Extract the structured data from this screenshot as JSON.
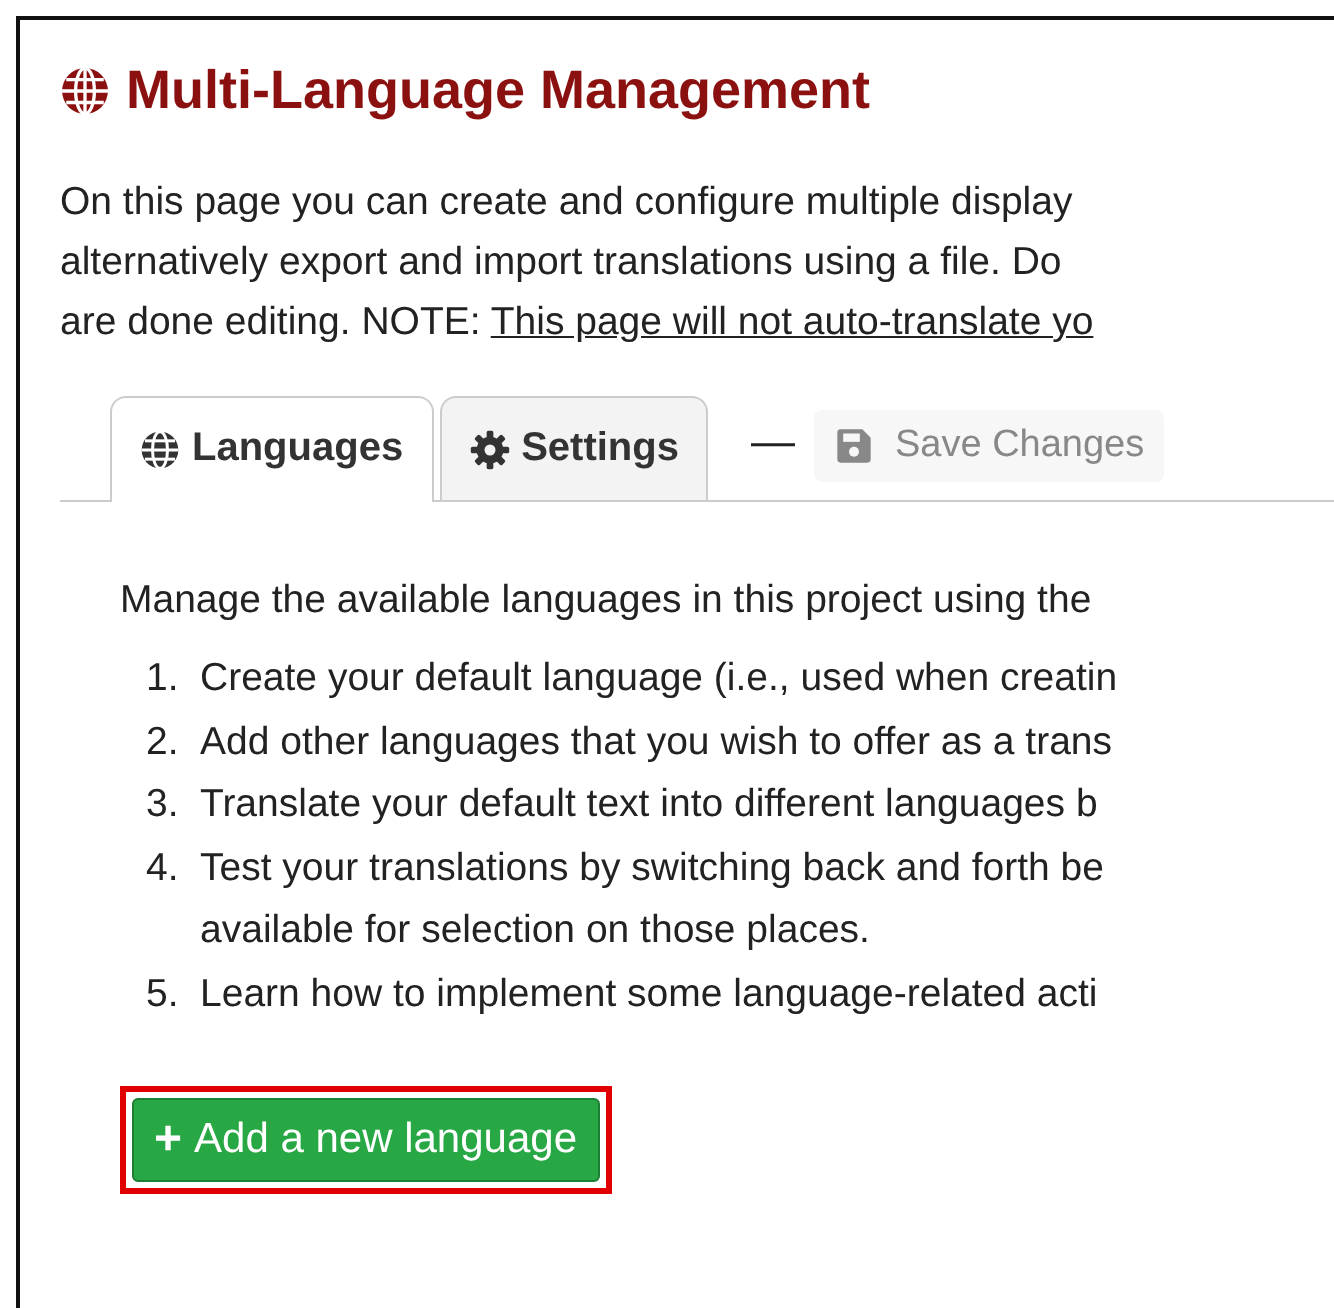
{
  "title": "Multi-Language Management",
  "intro": {
    "lines": [
      "On this page you can create and configure multiple display",
      "alternatively export and import translations using a file. Do"
    ],
    "last_line": "are done editing. NOTE: ",
    "note_link": "This page will not auto-translate yo"
  },
  "tabs": [
    {
      "label": "Languages",
      "kind": "globe",
      "selected": true
    },
    {
      "label": "Settings",
      "kind": "gear",
      "selected": false
    }
  ],
  "separator": "—",
  "save_button": {
    "label": "Save Changes",
    "disabled": true
  },
  "description": "Manage the available languages in this project using the",
  "steps": [
    {
      "number": "1.",
      "lines": [
        "Create your default language (i.e., used when creatin"
      ]
    },
    {
      "number": "2.",
      "lines": [
        "Add other languages that you wish to offer as a trans"
      ]
    },
    {
      "number": "3.",
      "lines": [
        "Translate your default text into different languages b"
      ]
    },
    {
      "number": "4.",
      "lines": [
        "Test your translations by switching back and forth be",
        "available for selection on those places."
      ]
    },
    {
      "number": "5.",
      "lines": [
        "Learn how to implement some language-related acti"
      ]
    }
  ],
  "add_button": {
    "icon": "+",
    "label": "Add a new language",
    "highlighted": true
  }
}
